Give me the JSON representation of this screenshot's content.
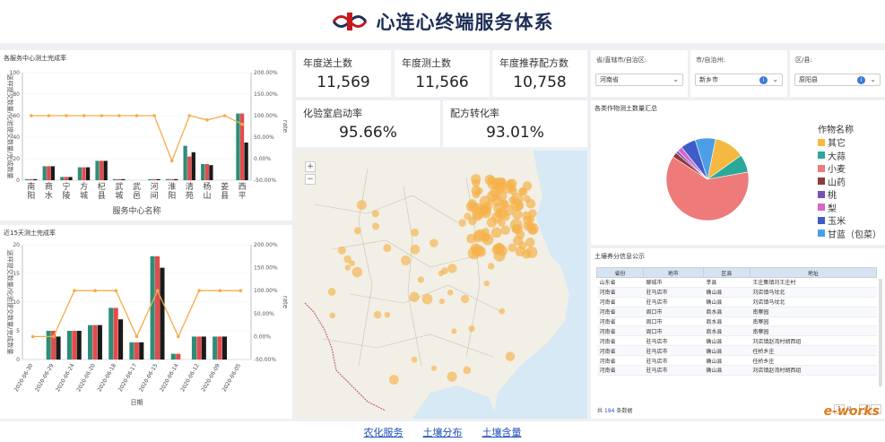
{
  "header": {
    "title": "心连心终端服务体系"
  },
  "kpis": {
    "annual_sent_label": "年度送土数",
    "annual_sent_value": "11,569",
    "annual_tested_label": "年度测土数",
    "annual_tested_value": "11,566",
    "annual_formula_label": "年度推荐配方数",
    "annual_formula_value": "10,758",
    "lab_rate_label": "化验室启动率",
    "lab_rate_value": "95.66%",
    "formula_rate_label": "配方转化率",
    "formula_rate_value": "93.01%"
  },
  "filters": {
    "province_label": "省/直辖市/自治区:",
    "province_value": "河南省",
    "city_label": "市/自治州:",
    "city_value": "新乡市",
    "county_label": "区/县:",
    "county_value": "原阳县"
  },
  "chart_top": {
    "panel_title": "各服务中心测土完成率",
    "ylabel": "送样提交数量/化验提交数量/完成数量",
    "y2label": "rate",
    "xlabel": "服务中心名称"
  },
  "chart_bottom": {
    "panel_title": "近15天测土完成率",
    "ylabel": "送样提交数量/化验提交数量/完成数量",
    "y2label": "rate",
    "xlabel": "日期"
  },
  "pie": {
    "panel_title": "各类作物测土数量汇总",
    "legend_title": "作物名称",
    "items": [
      {
        "name": "其它",
        "color": "#f5b942"
      },
      {
        "name": "大蒜",
        "color": "#2aa89a"
      },
      {
        "name": "小麦",
        "color": "#ee7a7a"
      },
      {
        "name": "山药",
        "color": "#8f3b3b"
      },
      {
        "name": "桃",
        "color": "#7b4fb8"
      },
      {
        "name": "梨",
        "color": "#d767c9"
      },
      {
        "name": "玉米",
        "color": "#3f5cc9"
      },
      {
        "name": "甘蓝（包菜）",
        "color": "#4c9fe6"
      }
    ]
  },
  "table": {
    "panel_title": "土壤养分信息公示",
    "headers": [
      "省份",
      "地市",
      "区县",
      "地址"
    ],
    "rows": [
      [
        "山东省",
        "聊城市",
        "莘县",
        "王庄集镇刘王庄村"
      ],
      [
        "河南省",
        "驻马店市",
        "确山县",
        "刘店镇马坟北"
      ],
      [
        "河南省",
        "驻马店市",
        "确山县",
        "刘店镇马坟北"
      ],
      [
        "河南省",
        "周口市",
        "商水县",
        "南寨园"
      ],
      [
        "河南省",
        "周口市",
        "商水县",
        "南寨园"
      ],
      [
        "河南省",
        "周口市",
        "商水县",
        "南寨园"
      ],
      [
        "河南省",
        "驻马店市",
        "确山县",
        "刘店镇赵湾村胡西组"
      ],
      [
        "河南省",
        "驻马店市",
        "确山县",
        "任桥乡庄"
      ],
      [
        "河南省",
        "驻马店市",
        "确山县",
        "任桥乡庄"
      ],
      [
        "河南省",
        "驻马店市",
        "确山县",
        "刘店镇赵湾村胡西组"
      ]
    ],
    "total_prefix": "共",
    "total_count": "194",
    "total_suffix": "条数据",
    "page_current": "1",
    "page_total": "/2"
  },
  "map": {
    "zoom_in": "+",
    "zoom_out": "−"
  },
  "footer": {
    "links": [
      "农化服务",
      "土壤分布",
      "土壤含量"
    ]
  },
  "watermark": "e-works",
  "chart_data": [
    {
      "type": "bar",
      "categories": [
        "南阳",
        "商水",
        "宁陵",
        "方城",
        "杞县",
        "武城",
        "武邑",
        "河间",
        "淮阳",
        "清苑",
        "杨山",
        "姜县",
        "西平"
      ],
      "series": [
        {
          "values": [
            1,
            13,
            3,
            12,
            18,
            1,
            0,
            1,
            1,
            32,
            15,
            0,
            62
          ],
          "color": "#2f8c78"
        },
        {
          "values": [
            1,
            13,
            3,
            12,
            18,
            1,
            0,
            1,
            1,
            22,
            15,
            0,
            62
          ],
          "color": "#e44b4b"
        },
        {
          "values": [
            1,
            13,
            3,
            12,
            18,
            1,
            0,
            1,
            1,
            26,
            14,
            0,
            35
          ],
          "color": "#1a1a1a"
        },
        {
          "values": [
            100,
            100,
            100,
            100,
            100,
            100,
            100,
            100,
            -5,
            100,
            90,
            100,
            80
          ],
          "color": "#f5ac4a",
          "type": "line",
          "axis": "right"
        }
      ],
      "ylim": [
        0,
        100
      ],
      "y2lim": [
        -50,
        200
      ],
      "yticks": [
        "0",
        "20",
        "40",
        "60",
        "80",
        "100"
      ],
      "y2ticks": [
        "-50.00%",
        "0.00%",
        "50.00%",
        "100.00%",
        "150.00%",
        "200.00%"
      ]
    },
    {
      "type": "bar",
      "categories": [
        "2020-06-30",
        "2020-06-29",
        "2020-06-24",
        "2020-06-20",
        "2020-06-18",
        "2020-06-17",
        "2020-06-15",
        "2020-06-14",
        "2020-06-12",
        "2020-06-09",
        "2020-06-05"
      ],
      "series": [
        {
          "values": [
            0,
            5,
            5,
            6,
            9,
            3,
            18,
            1,
            4,
            4,
            0
          ],
          "color": "#2f8c78"
        },
        {
          "values": [
            0,
            5,
            5,
            6,
            9,
            3,
            18,
            1,
            4,
            4,
            0
          ],
          "color": "#e44b4b"
        },
        {
          "values": [
            0,
            4,
            5,
            6,
            7,
            3,
            16,
            0,
            4,
            4,
            0
          ],
          "color": "#1a1a1a"
        },
        {
          "values": [
            0,
            0,
            100,
            100,
            100,
            0,
            100,
            0,
            100,
            100,
            100
          ],
          "color": "#f5ac4a",
          "type": "line",
          "axis": "right"
        }
      ],
      "ylim": [
        0,
        20
      ],
      "y2lim": [
        -50,
        200
      ],
      "yticks": [
        "0",
        "5",
        "10",
        "15",
        "20"
      ],
      "y2ticks": [
        "-50.00%",
        "0.00%",
        "50.00%",
        "100.00%",
        "150.00%",
        "200.00%"
      ]
    },
    {
      "type": "pie",
      "categories": [
        "其它",
        "大蒜",
        "小麦",
        "山药",
        "桃",
        "梨",
        "玉米",
        "甘蓝（包菜）"
      ],
      "values": [
        12,
        7,
        62,
        2,
        1,
        2,
        6,
        8
      ]
    }
  ]
}
